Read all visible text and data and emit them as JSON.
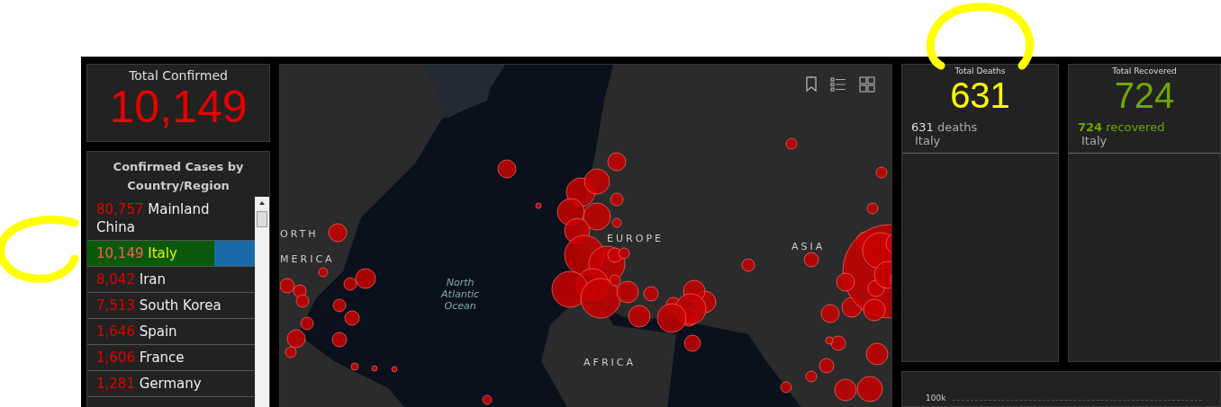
{
  "total_confirmed": {
    "title": "Total Confirmed",
    "value": "10,149"
  },
  "country_list": {
    "title": "Confirmed Cases by Country/Region",
    "items": [
      {
        "count": "80,757",
        "name": "Mainland China",
        "selected": false
      },
      {
        "count": "10,149",
        "name": "Italy",
        "selected": true
      },
      {
        "count": "8,042",
        "name": "Iran",
        "selected": false
      },
      {
        "count": "7,513",
        "name": "South Korea",
        "selected": false
      },
      {
        "count": "1,646",
        "name": "Spain",
        "selected": false
      },
      {
        "count": "1,606",
        "name": "France",
        "selected": false
      },
      {
        "count": "1,281",
        "name": "Germany",
        "selected": false
      }
    ]
  },
  "map": {
    "labels": [
      {
        "text": "ORTH",
        "kind": "region"
      },
      {
        "text": "MERICA",
        "kind": "region"
      },
      {
        "text": "EUROPE",
        "kind": "region"
      },
      {
        "text": "ASIA",
        "kind": "region"
      },
      {
        "text": "AFRICA",
        "kind": "region"
      },
      {
        "text": "North Atlantic Ocean",
        "kind": "ocean"
      }
    ]
  },
  "deaths": {
    "title": "Total Deaths",
    "value": "631",
    "detail_count": "631",
    "detail_word": "deaths",
    "place": "Italy"
  },
  "recovered": {
    "title": "Total Recovered",
    "value": "724",
    "detail_count": "724",
    "detail_word": "recovered",
    "place": "Italy"
  },
  "chart": {
    "tick": "100k"
  }
}
